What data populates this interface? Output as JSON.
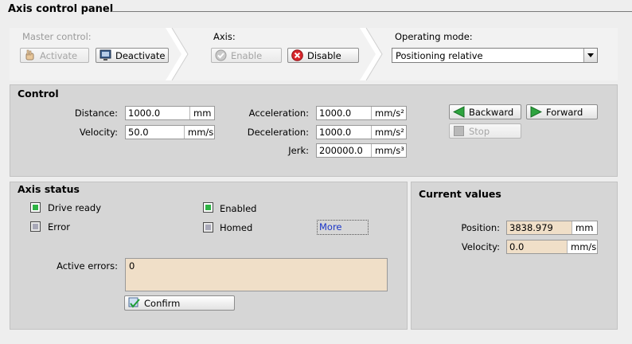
{
  "window": {
    "title": "Axis control panel"
  },
  "steps": {
    "master_control": {
      "label": "Master control:",
      "activate": "Activate",
      "deactivate": "Deactivate"
    },
    "axis": {
      "label": "Axis:",
      "enable": "Enable",
      "disable": "Disable"
    },
    "operating_mode": {
      "label": "Operating mode:",
      "selected": "Positioning relative"
    }
  },
  "control": {
    "title": "Control",
    "distance": {
      "label": "Distance:",
      "value": "1000.0",
      "unit": "mm"
    },
    "velocity": {
      "label": "Velocity:",
      "value": "50.0",
      "unit": "mm/s"
    },
    "acceleration": {
      "label": "Acceleration:",
      "value": "1000.0",
      "unit": "mm/s²"
    },
    "deceleration": {
      "label": "Deceleration:",
      "value": "1000.0",
      "unit": "mm/s²"
    },
    "jerk": {
      "label": "Jerk:",
      "value": "200000.0",
      "unit": "mm/s³"
    },
    "backward": "Backward",
    "forward": "Forward",
    "stop": "Stop"
  },
  "axis_status": {
    "title": "Axis status",
    "drive_ready": "Drive ready",
    "enabled": "Enabled",
    "error": "Error",
    "homed": "Homed",
    "more": "More",
    "active_errors_label": "Active errors:",
    "active_errors_value": "0",
    "confirm": "Confirm"
  },
  "current_values": {
    "title": "Current values",
    "position": {
      "label": "Position:",
      "value": "3838.979",
      "unit": "mm"
    },
    "velocity": {
      "label": "Velocity:",
      "value": "0.0",
      "unit": "mm/s"
    }
  },
  "colors": {
    "status_green": "#2fb345",
    "link_blue": "#1a35c8",
    "readonly_field": "#f0dfc8",
    "disable_red": "#d8262c"
  }
}
